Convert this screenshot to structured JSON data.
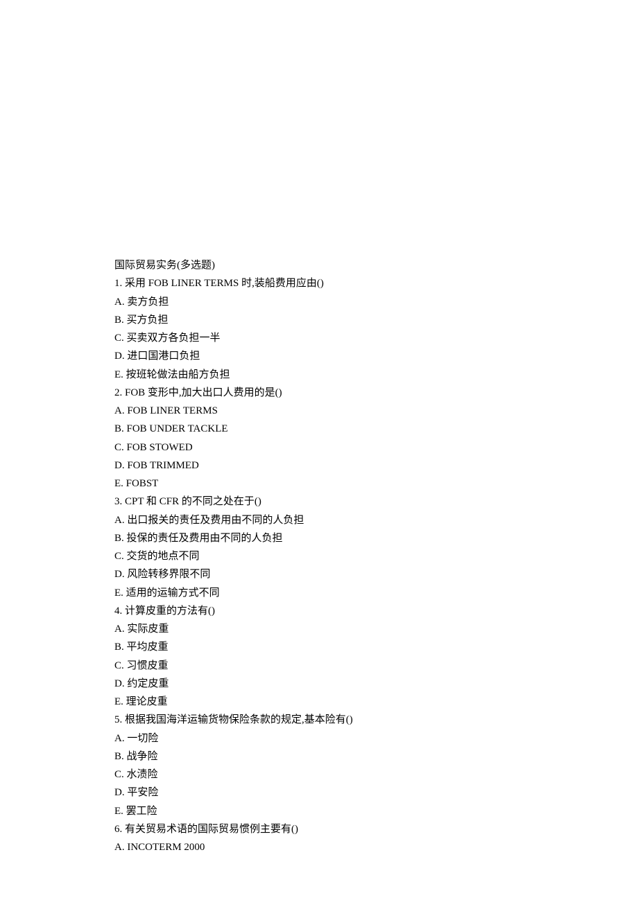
{
  "title": "国际贸易实务(多选题)",
  "questions": [
    {
      "number": "1.",
      "text": "采用 FOB LINER TERMS 时,装船费用应由()",
      "options": [
        {
          "label": "A.",
          "text": "卖方负担"
        },
        {
          "label": "B.",
          "text": "买方负担"
        },
        {
          "label": "C.",
          "text": "买卖双方各负担一半"
        },
        {
          "label": "D.",
          "text": "进口国港口负担"
        },
        {
          "label": "E.",
          "text": "按班轮做法由船方负担"
        }
      ]
    },
    {
      "number": "2.",
      "text": "FOB 变形中,加大出口人费用的是()",
      "options": [
        {
          "label": "A.",
          "text": "FOB LINER TERMS"
        },
        {
          "label": "B.",
          "text": "FOB UNDER TACKLE"
        },
        {
          "label": "C.",
          "text": "FOB STOWED"
        },
        {
          "label": "D.",
          "text": "FOB TRIMMED"
        },
        {
          "label": "E.",
          "text": "FOBST"
        }
      ]
    },
    {
      "number": "3.",
      "text": "CPT 和 CFR 的不同之处在于()",
      "options": [
        {
          "label": "A.",
          "text": "出口报关的责任及费用由不同的人负担"
        },
        {
          "label": "B.",
          "text": "投保的责任及费用由不同的人负担"
        },
        {
          "label": "C.",
          "text": "交货的地点不同"
        },
        {
          "label": "D.",
          "text": "风险转移界限不同"
        },
        {
          "label": "E.",
          "text": "适用的运输方式不同"
        }
      ]
    },
    {
      "number": "4.",
      "text": "计算皮重的方法有()",
      "options": [
        {
          "label": "A.",
          "text": "实际皮重"
        },
        {
          "label": "B.",
          "text": "平均皮重"
        },
        {
          "label": "C.",
          "text": "习惯皮重"
        },
        {
          "label": "D.",
          "text": "约定皮重"
        },
        {
          "label": "E.",
          "text": "理论皮重"
        }
      ]
    },
    {
      "number": "5.",
      "text": "根据我国海洋运输货物保险条款的规定,基本险有()",
      "options": [
        {
          "label": "A.",
          "text": "一切险"
        },
        {
          "label": "B.",
          "text": "战争险"
        },
        {
          "label": "C.",
          "text": "水渍险"
        },
        {
          "label": "D.",
          "text": "平安险"
        },
        {
          "label": "E.",
          "text": "罢工险"
        }
      ]
    },
    {
      "number": "6.",
      "text": "有关贸易术语的国际贸易惯例主要有()",
      "options": [
        {
          "label": "A.",
          "text": "INCOTERM 2000"
        }
      ]
    }
  ]
}
